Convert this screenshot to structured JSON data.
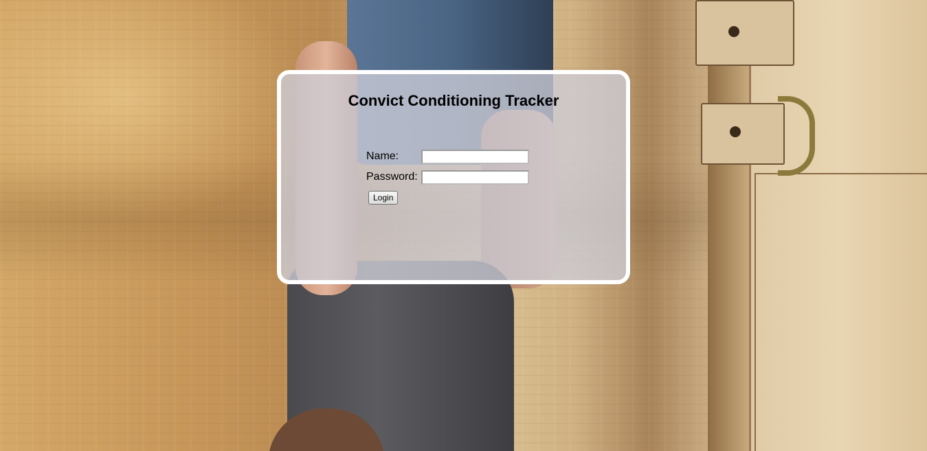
{
  "page": {
    "background": "photo of man doing handstand against wall"
  },
  "login": {
    "title": "Convict Conditioning Tracker",
    "name_label": "Name:",
    "name_value": "",
    "password_label": "Password:",
    "password_value": "",
    "button_label": "Login"
  },
  "colors": {
    "panel_border": "#ffffff",
    "panel_fill": "rgba(205,205,215,0.78)",
    "text": "#000000"
  }
}
